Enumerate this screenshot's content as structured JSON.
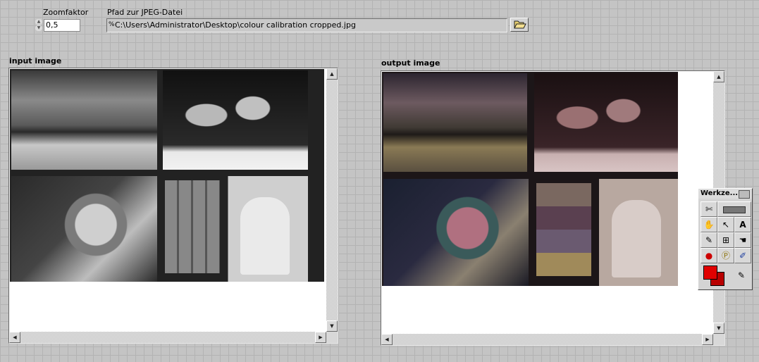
{
  "zoom": {
    "label": "Zoomfaktor",
    "value": "0,5"
  },
  "path": {
    "label": "Pfad zur JPEG-Datei",
    "value": "C:\\Users\\Administrator\\Desktop\\colour calibration cropped.jpg"
  },
  "input_display": {
    "label": "input image"
  },
  "output_display": {
    "label": "output image"
  },
  "tools_palette": {
    "title": "Werkze...",
    "foreground_color": "#e00000",
    "background_color": "#b80000"
  },
  "icons": {
    "spinner_up": "▲",
    "spinner_down": "▼",
    "path_icon": "%",
    "browse": "folder-open-icon",
    "scroll_up": "▲",
    "scroll_down": "▼",
    "scroll_left": "◀",
    "scroll_right": "▶",
    "tools": [
      "✄",
      "▭",
      "✋",
      "↖",
      "A",
      "✎",
      "⊞",
      "☚",
      "●",
      "Ⓟ",
      "✐",
      "✎"
    ]
  }
}
